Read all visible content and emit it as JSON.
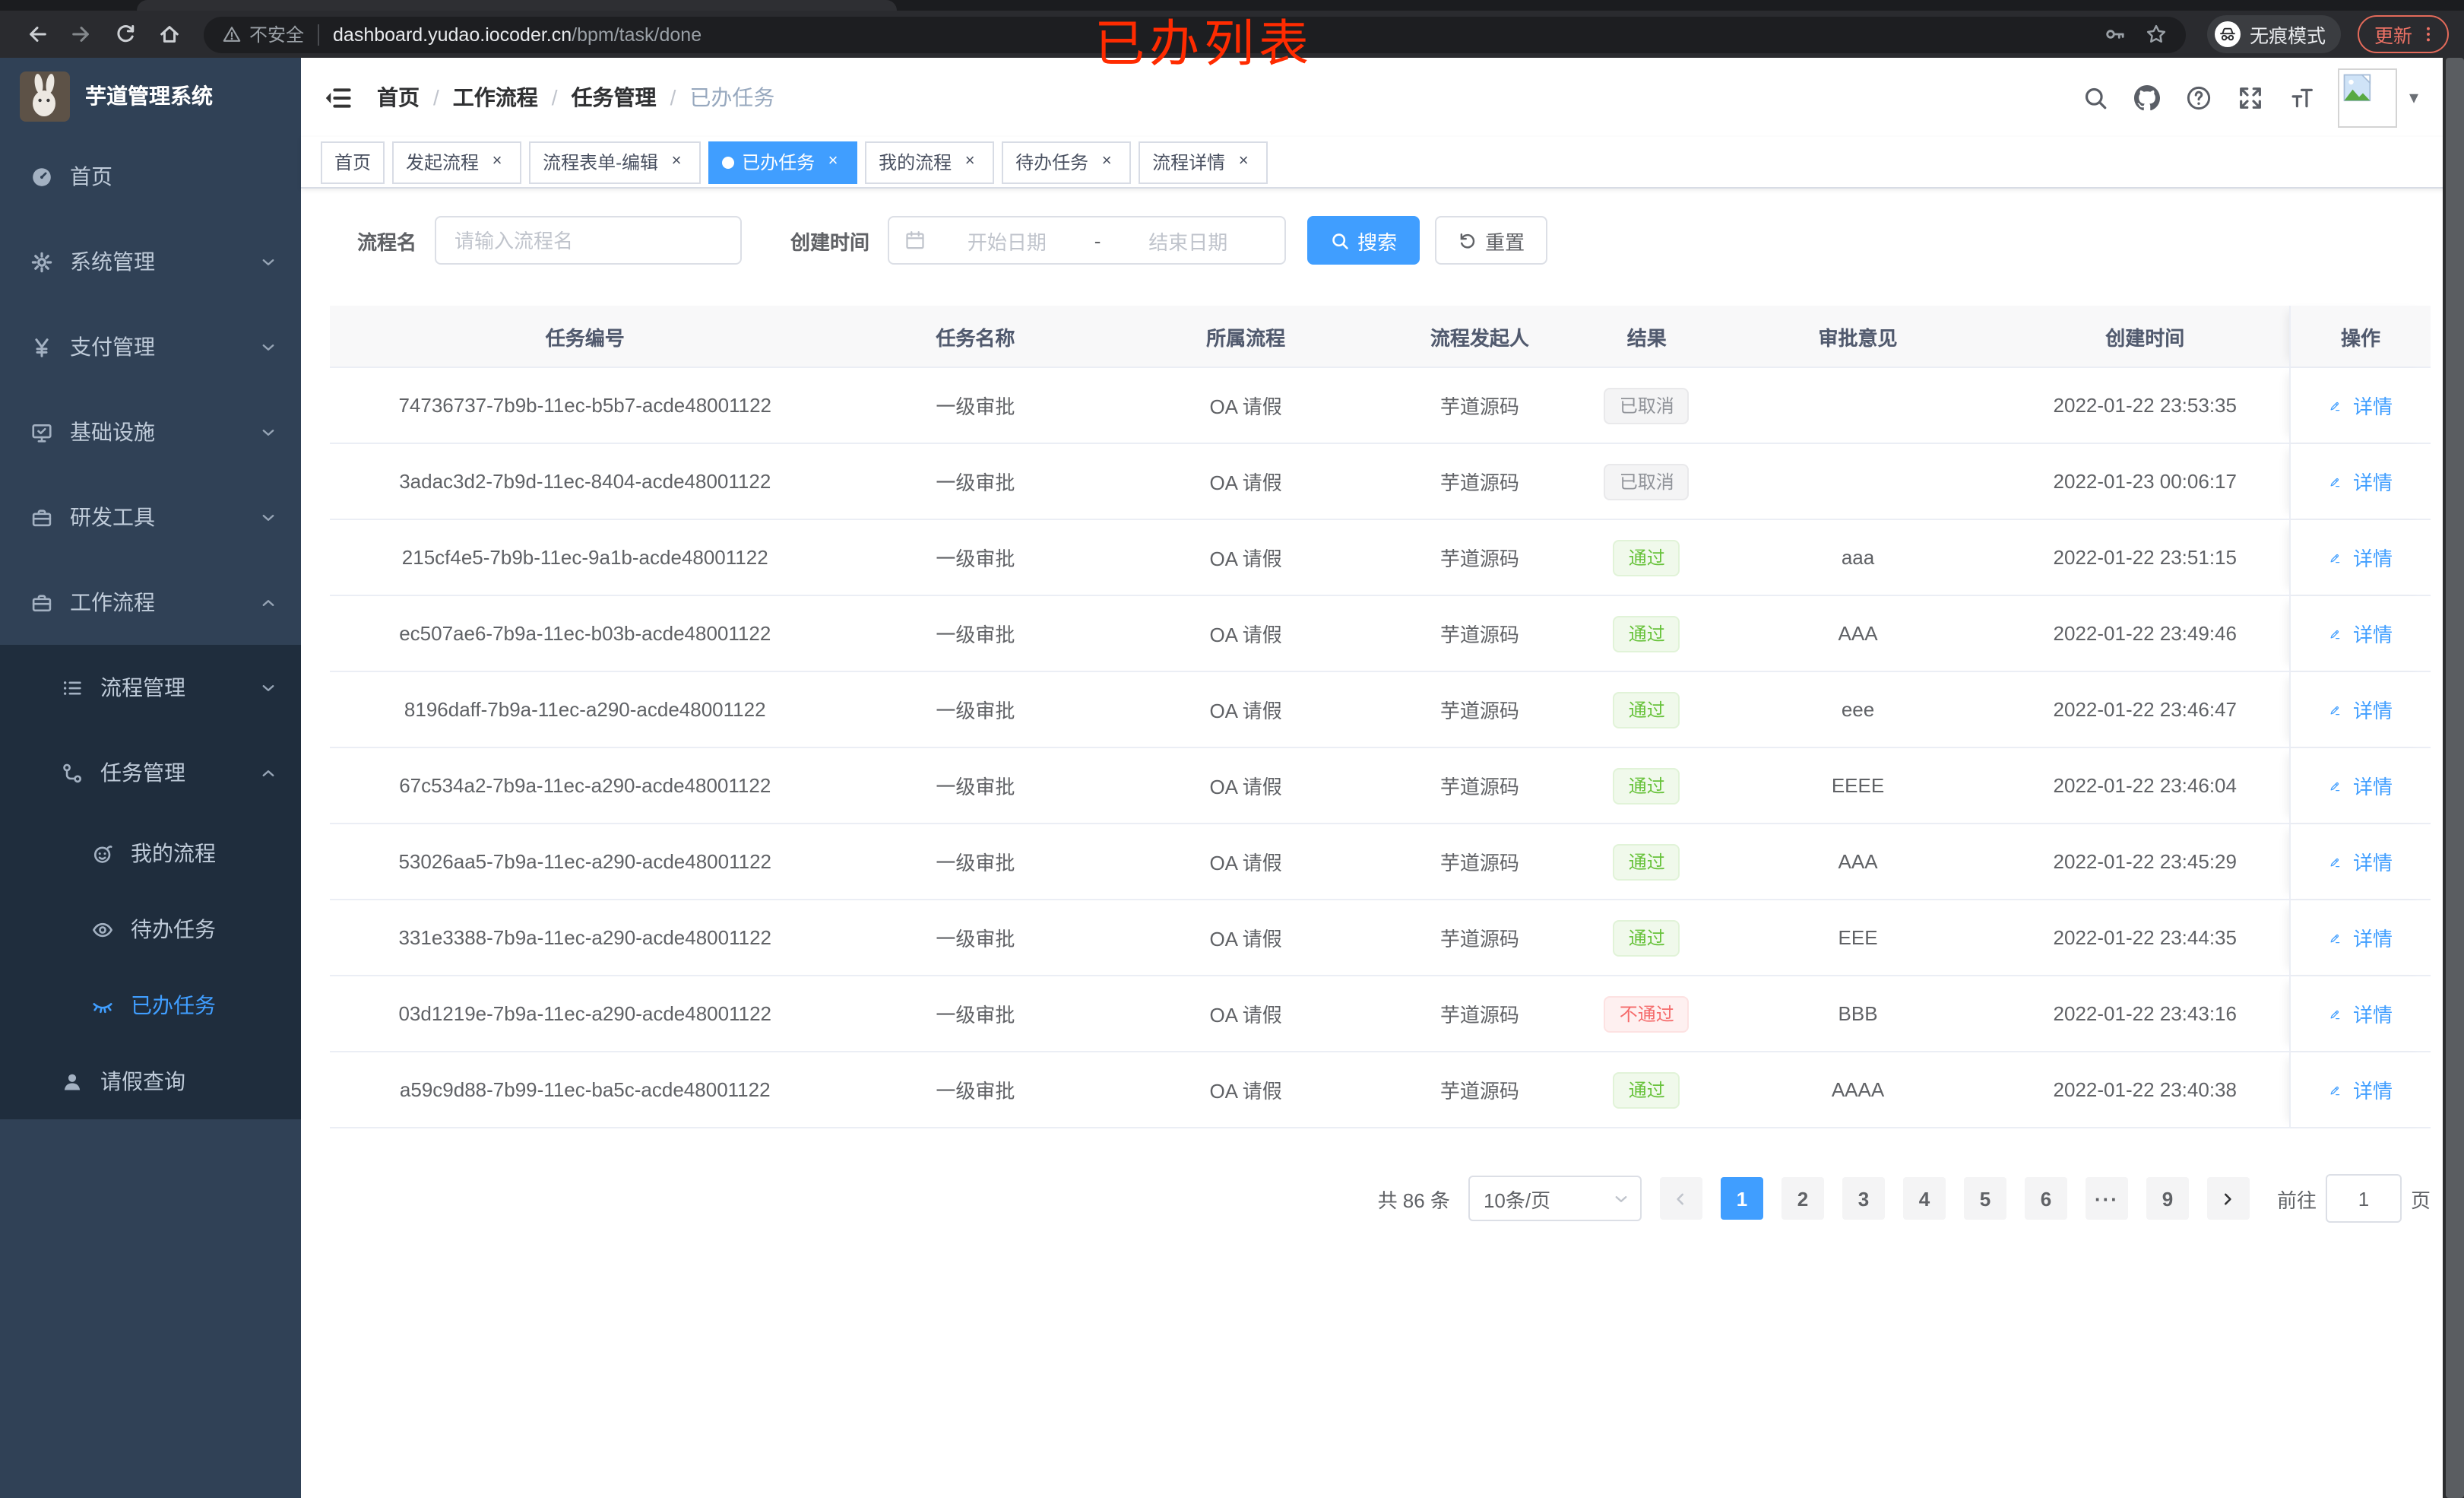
{
  "browser": {
    "security_label": "不安全",
    "url_host": "dashboard.yudao.iocoder.cn",
    "url_path": "/bpm/task/done",
    "incognito_label": "无痕模式",
    "update_label": "更新"
  },
  "annotation": {
    "text": "已办列表",
    "color": "#ff2b00"
  },
  "app": {
    "logo_title": "芋道管理系统",
    "breadcrumb": [
      "首页",
      "工作流程",
      "任务管理",
      "已办任务"
    ]
  },
  "sidebar": {
    "items": [
      {
        "key": "home",
        "label": "首页",
        "icon": "dashboard-icon",
        "level": 1
      },
      {
        "key": "system",
        "label": "系统管理",
        "icon": "gear-icon",
        "level": 1,
        "expand": "down"
      },
      {
        "key": "payment",
        "label": "支付管理",
        "icon": "yen-icon",
        "level": 1,
        "expand": "down"
      },
      {
        "key": "infrastructure",
        "label": "基础设施",
        "icon": "monitor-icon",
        "level": 1,
        "expand": "down"
      },
      {
        "key": "devtools",
        "label": "研发工具",
        "icon": "toolbox-icon",
        "level": 1,
        "expand": "down"
      },
      {
        "key": "workflow",
        "label": "工作流程",
        "icon": "toolbox-icon",
        "level": 1,
        "expand": "up"
      },
      {
        "key": "process-mgmt",
        "label": "流程管理",
        "icon": "list-tree-icon",
        "level": 2,
        "dark": true,
        "expand": "down"
      },
      {
        "key": "task-mgmt",
        "label": "任务管理",
        "icon": "flow-icon",
        "level": 2,
        "dark": true,
        "expand": "up"
      },
      {
        "key": "my-process",
        "label": "我的流程",
        "icon": "robot-icon",
        "level": 3,
        "dark": true,
        "leaf": true
      },
      {
        "key": "todo-tasks",
        "label": "待办任务",
        "icon": "eye-icon",
        "level": 3,
        "dark": true,
        "leaf": true
      },
      {
        "key": "done-tasks",
        "label": "已办任务",
        "icon": "eye-closed-icon",
        "level": 3,
        "dark": true,
        "leaf": true,
        "active": true
      },
      {
        "key": "leave-query",
        "label": "请假查询",
        "icon": "user-icon",
        "level": 2,
        "dark": true,
        "leaf": true
      }
    ]
  },
  "tabs": [
    {
      "key": "home",
      "label": "首页",
      "closable": false,
      "active": false
    },
    {
      "key": "start-process",
      "label": "发起流程",
      "closable": true,
      "active": false
    },
    {
      "key": "form-edit",
      "label": "流程表单-编辑",
      "closable": true,
      "active": false
    },
    {
      "key": "done-tasks",
      "label": "已办任务",
      "closable": true,
      "active": true
    },
    {
      "key": "my-process",
      "label": "我的流程",
      "closable": true,
      "active": false
    },
    {
      "key": "todo-tasks",
      "label": "待办任务",
      "closable": true,
      "active": false
    },
    {
      "key": "process-detail",
      "label": "流程详情",
      "closable": true,
      "active": false
    }
  ],
  "filters": {
    "name_label": "流程名",
    "name_placeholder": "请输入流程名",
    "time_label": "创建时间",
    "start_placeholder": "开始日期",
    "range_separator": "-",
    "end_placeholder": "结束日期",
    "search_label": "搜索",
    "reset_label": "重置"
  },
  "table": {
    "columns": [
      "任务编号",
      "任务名称",
      "所属流程",
      "流程发起人",
      "结果",
      "审批意见",
      "创建时间",
      "操作"
    ],
    "action_label": "详情",
    "rows": [
      {
        "id": "74736737-7b9b-11ec-b5b7-acde48001122",
        "name": "一级审批",
        "process": "OA 请假",
        "starter": "芋道源码",
        "result": "已取消",
        "result_type": "info",
        "comment": "",
        "created": "2022-01-22 23:53:35"
      },
      {
        "id": "3adac3d2-7b9d-11ec-8404-acde48001122",
        "name": "一级审批",
        "process": "OA 请假",
        "starter": "芋道源码",
        "result": "已取消",
        "result_type": "info",
        "comment": "",
        "created": "2022-01-23 00:06:17"
      },
      {
        "id": "215cf4e5-7b9b-11ec-9a1b-acde48001122",
        "name": "一级审批",
        "process": "OA 请假",
        "starter": "芋道源码",
        "result": "通过",
        "result_type": "success",
        "comment": "aaa",
        "created": "2022-01-22 23:51:15"
      },
      {
        "id": "ec507ae6-7b9a-11ec-b03b-acde48001122",
        "name": "一级审批",
        "process": "OA 请假",
        "starter": "芋道源码",
        "result": "通过",
        "result_type": "success",
        "comment": "AAA",
        "created": "2022-01-22 23:49:46"
      },
      {
        "id": "8196daff-7b9a-11ec-a290-acde48001122",
        "name": "一级审批",
        "process": "OA 请假",
        "starter": "芋道源码",
        "result": "通过",
        "result_type": "success",
        "comment": "eee",
        "created": "2022-01-22 23:46:47"
      },
      {
        "id": "67c534a2-7b9a-11ec-a290-acde48001122",
        "name": "一级审批",
        "process": "OA 请假",
        "starter": "芋道源码",
        "result": "通过",
        "result_type": "success",
        "comment": "EEEE",
        "created": "2022-01-22 23:46:04"
      },
      {
        "id": "53026aa5-7b9a-11ec-a290-acde48001122",
        "name": "一级审批",
        "process": "OA 请假",
        "starter": "芋道源码",
        "result": "通过",
        "result_type": "success",
        "comment": "AAA",
        "created": "2022-01-22 23:45:29"
      },
      {
        "id": "331e3388-7b9a-11ec-a290-acde48001122",
        "name": "一级审批",
        "process": "OA 请假",
        "starter": "芋道源码",
        "result": "通过",
        "result_type": "success",
        "comment": "EEE",
        "created": "2022-01-22 23:44:35"
      },
      {
        "id": "03d1219e-7b9a-11ec-a290-acde48001122",
        "name": "一级审批",
        "process": "OA 请假",
        "starter": "芋道源码",
        "result": "不通过",
        "result_type": "danger",
        "comment": "BBB",
        "created": "2022-01-22 23:43:16"
      },
      {
        "id": "a59c9d88-7b99-11ec-ba5c-acde48001122",
        "name": "一级审批",
        "process": "OA 请假",
        "starter": "芋道源码",
        "result": "通过",
        "result_type": "success",
        "comment": "AAAA",
        "created": "2022-01-22 23:40:38"
      }
    ]
  },
  "pagination": {
    "total_label": "共 86 条",
    "page_size_label": "10条/页",
    "pages": [
      {
        "label": "1",
        "active": true
      },
      {
        "label": "2"
      },
      {
        "label": "3"
      },
      {
        "label": "4"
      },
      {
        "label": "5"
      },
      {
        "label": "6"
      },
      {
        "label": "···",
        "more": true
      },
      {
        "label": "9"
      }
    ],
    "goto_label": "前往",
    "goto_value": "1",
    "unit_label": "页"
  },
  "colors": {
    "accent": "#409eff",
    "success": "#67c23a",
    "danger": "#f56c6c",
    "info": "#909399",
    "sidebar_bg": "#304156",
    "submenu_bg": "#1f2d3d",
    "annotation": "#ff2b00"
  }
}
